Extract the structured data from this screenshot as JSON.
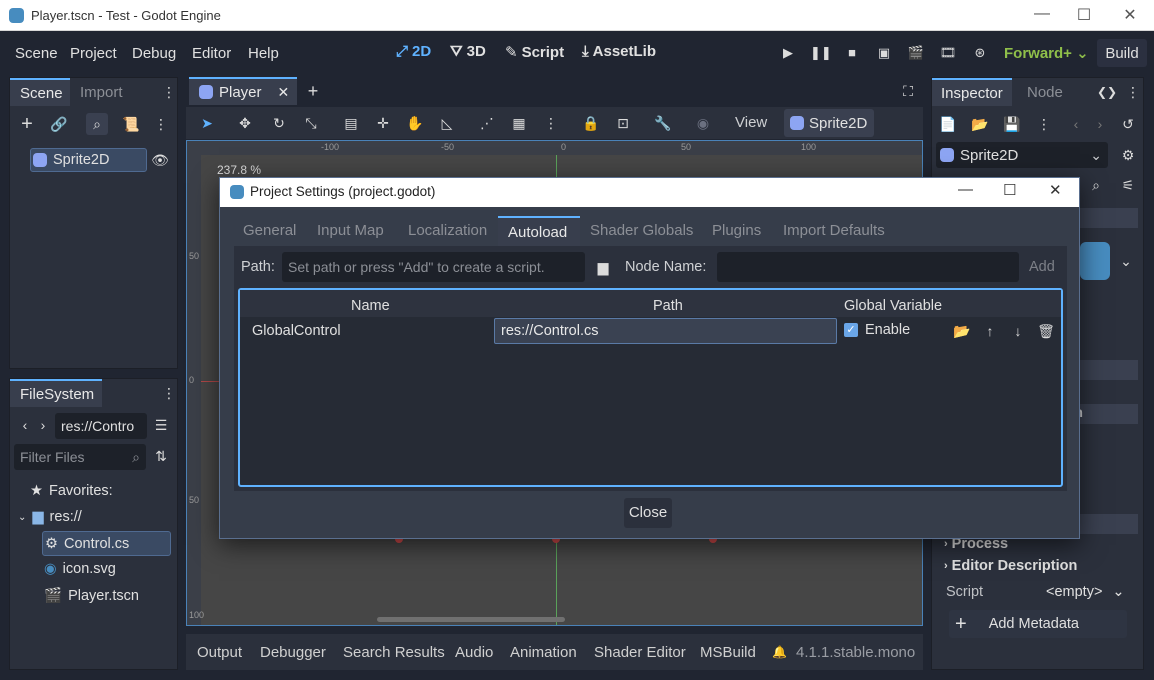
{
  "window": {
    "title": "Player.tscn - Test - Godot Engine",
    "controls": [
      "—",
      "☐",
      "✕"
    ]
  },
  "menubar": {
    "menus": [
      "Scene",
      "Project",
      "Debug",
      "Editor",
      "Help"
    ],
    "workspaces": [
      {
        "icon": "⤢",
        "label": "2D"
      },
      {
        "icon": "⛛",
        "label": "3D"
      },
      {
        "icon": "✎",
        "label": "Script"
      },
      {
        "icon": "⤓",
        "label": "AssetLib"
      }
    ],
    "renderer": "Forward+ ⌄",
    "build": "Build",
    "accent_color": "#5fb2ff",
    "renderer_color": "#8fbf4a"
  },
  "scene_dock": {
    "tabs": [
      "Scene",
      "Import"
    ],
    "root_node": "Sprite2D"
  },
  "filesystem_dock": {
    "tab": "FileSystem",
    "path": "res://Contro",
    "filter_placeholder": "Filter Files",
    "items": [
      {
        "label": "Favorites:",
        "icon": "★"
      },
      {
        "label": "res://",
        "icon": "▆"
      },
      {
        "label": "Control.cs",
        "icon": "⚙"
      },
      {
        "label": "icon.svg",
        "icon": "◉"
      },
      {
        "label": "Player.tscn",
        "icon": "🎬"
      }
    ]
  },
  "editor": {
    "scene_tab": "Player",
    "close_tab": "✕",
    "add_tab": "+",
    "view_menu": "View",
    "selected_node": "Sprite2D",
    "zoom": "237.8 %",
    "ruler_top": [
      "-100",
      "-50",
      "0",
      "50",
      "100"
    ],
    "ruler_left": [
      "50",
      "0",
      "50",
      "100"
    ]
  },
  "bottom_panel": {
    "tabs": [
      "Output",
      "Debugger",
      "Search Results",
      "Audio",
      "Animation",
      "Shader Editor",
      "MSBuild"
    ],
    "version": "4.1.1.stable.mono"
  },
  "inspector": {
    "tabs": [
      "Inspector",
      "Node"
    ],
    "node": "Sprite2D",
    "section_process": "Process",
    "section_editor_desc": "Editor Description",
    "script_label": "Script",
    "script_value": "<empty>",
    "add_metadata": "Add Metadata",
    "partial_label": "m"
  },
  "dialog": {
    "title": "Project Settings (project.godot)",
    "tabs": [
      "General",
      "Input Map",
      "Localization",
      "Autoload",
      "Shader Globals",
      "Plugins",
      "Import Defaults"
    ],
    "path_label": "Path:",
    "path_placeholder": "Set path or press \"Add\" to create a script.",
    "node_name_label": "Node Name:",
    "node_name_value": "",
    "add_button": "Add",
    "columns": [
      "Name",
      "Path",
      "Global Variable"
    ],
    "rows": [
      {
        "name": "GlobalControl",
        "path": "res://Control.cs",
        "enable_label": "Enable",
        "enabled": true
      }
    ],
    "close_button": "Close"
  }
}
